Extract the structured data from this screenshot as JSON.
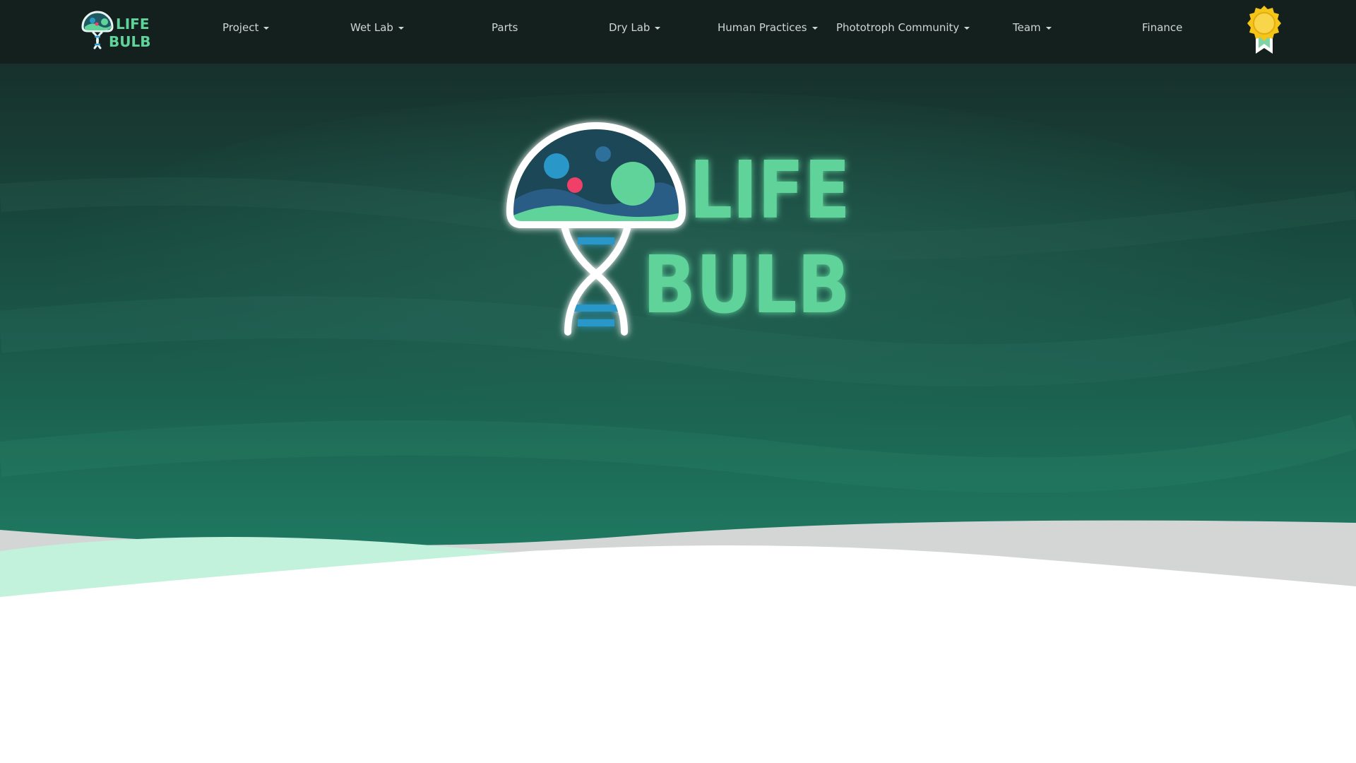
{
  "brand": {
    "logo_text_line1": "LIFE",
    "logo_text_line2": "BULB",
    "accent_green": "#5fd39a",
    "accent_blue": "#2a97c9",
    "accent_pink": "#f0406a",
    "nav_background": "#14201d",
    "hero_teal": "#1d6a58"
  },
  "nav": {
    "items": [
      {
        "label": "Project",
        "has_dropdown": true
      },
      {
        "label": "Wet Lab",
        "has_dropdown": true
      },
      {
        "label": "Parts",
        "has_dropdown": false
      },
      {
        "label": "Dry Lab",
        "has_dropdown": true
      },
      {
        "label": "Human Practices",
        "has_dropdown": true
      },
      {
        "label": "Phototroph Community",
        "has_dropdown": true
      },
      {
        "label": "Team",
        "has_dropdown": true
      },
      {
        "label": "Finance",
        "has_dropdown": false
      }
    ],
    "medal_icon": "gold-medal-ribbon-icon"
  },
  "hero": {
    "logo_icon": "lightbulb-dna-icon"
  }
}
